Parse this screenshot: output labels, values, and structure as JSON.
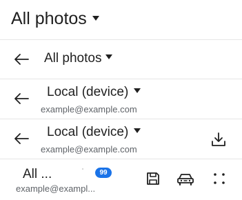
{
  "header": {
    "title": "All photos"
  },
  "rows": [
    {
      "title": "All photos",
      "subtitle": ""
    },
    {
      "title": "Local (device)",
      "subtitle": "example@example.com"
    },
    {
      "title": "Local (device)",
      "subtitle": "example@example.com",
      "action_icon": "download-icon"
    }
  ],
  "bottom_bar": {
    "title": "All ...",
    "subtitle": "example@exampl...",
    "badge_count": "99",
    "icons": [
      "save-icon",
      "car-icon",
      "more-dots-icon"
    ]
  },
  "colors": {
    "text": "#1f1f1f",
    "secondary_text": "#5f6368",
    "badge": "#1a73e8",
    "divider": "#e6e6e6"
  }
}
